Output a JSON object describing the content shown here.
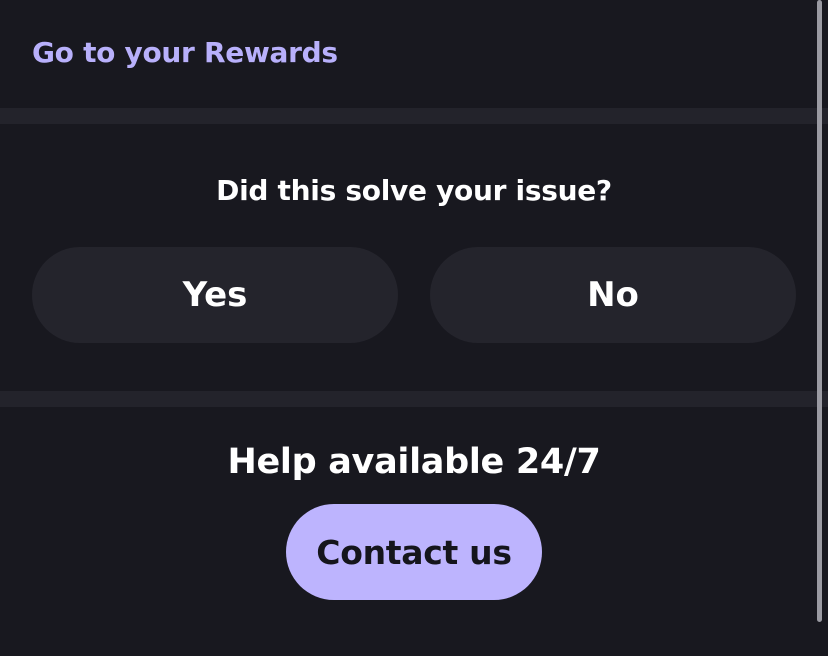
{
  "rewards": {
    "link_label": "Go to your Rewards"
  },
  "feedback": {
    "question": "Did this solve your issue?",
    "yes_label": "Yes",
    "no_label": "No"
  },
  "help": {
    "title": "Help available 24/7",
    "contact_label": "Contact us"
  },
  "colors": {
    "background": "#18181f",
    "divider": "#23232b",
    "button_dark": "#24242c",
    "accent": "#bdb4fe",
    "link": "#b8b0fb",
    "text": "#ffffff"
  }
}
